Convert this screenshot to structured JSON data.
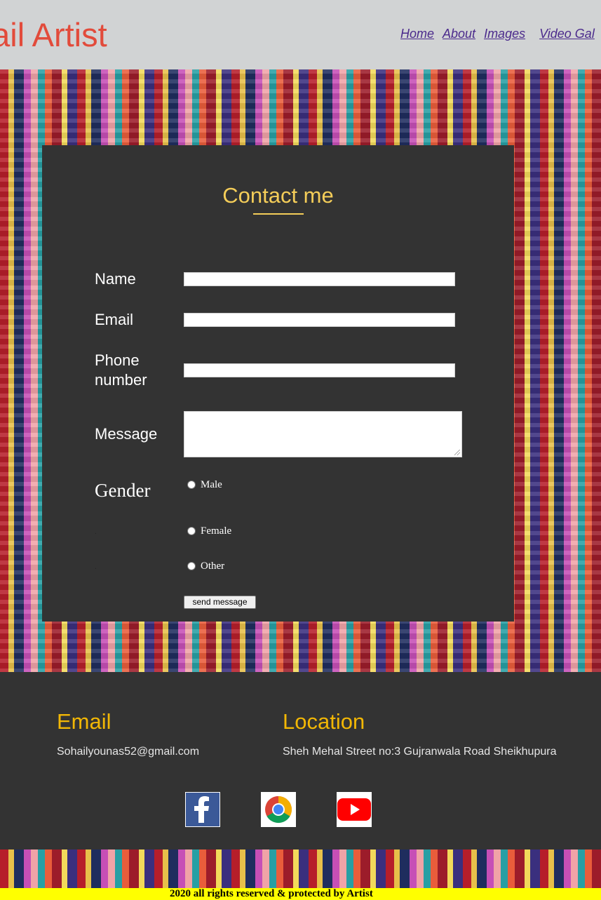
{
  "header": {
    "brand": "hail Artist",
    "nav": [
      "Home",
      "About",
      "Images",
      "Video Gal"
    ]
  },
  "contact": {
    "title": "Contact me",
    "labels": {
      "name": "Name",
      "email": "Email",
      "phone_line1": "Phone",
      "phone_line2": "number",
      "message": "Message",
      "gender": "Gender"
    },
    "fields": {
      "name_value": "",
      "email_value": "",
      "phone_value": "",
      "message_value": ""
    },
    "gender_options": [
      "Male",
      "Female",
      "Other"
    ],
    "submit_label": "send message"
  },
  "footer": {
    "email_heading": "Email",
    "email_value": "Sohailyounas52@gmail.com",
    "location_heading": "Location",
    "location_value": "Sheh Mehal Street no:3 Gujranwala Road Sheikhupura",
    "social_icons": [
      "facebook-icon",
      "chrome-icon",
      "youtube-icon"
    ]
  },
  "copyright": "2020 all rights reserved & protected by Artist",
  "colors": {
    "brand": "#e24b3b",
    "accent_title": "#f4cd59",
    "footer_heading": "#f2b705",
    "panel_bg": "#333333",
    "copyright_bg": "#ffff00"
  }
}
